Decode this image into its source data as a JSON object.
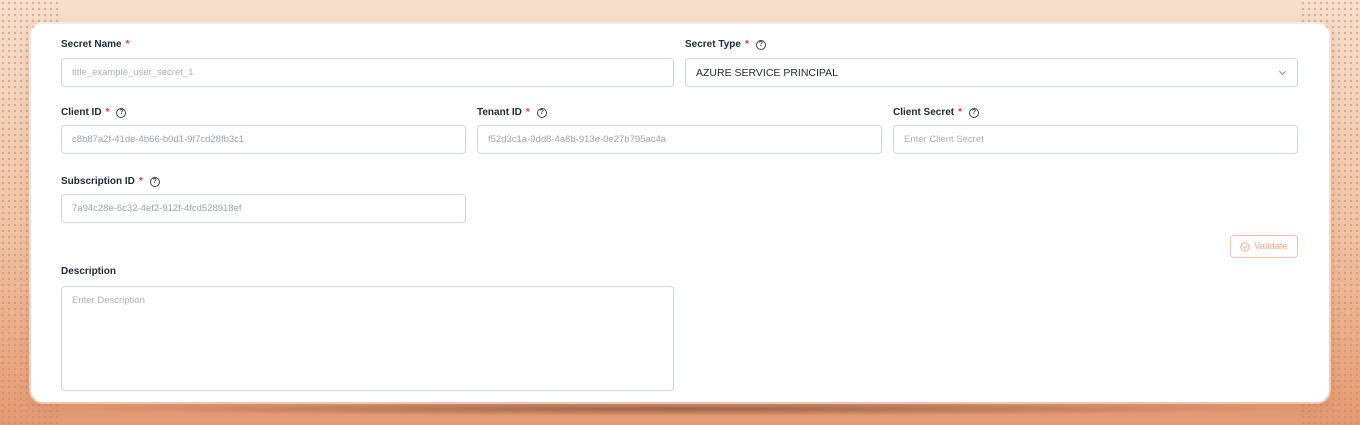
{
  "form": {
    "secret_name": {
      "label": "Secret Name",
      "required_mark": "*",
      "placeholder": "title_example_user_secret_1"
    },
    "secret_type": {
      "label": "Secret Type",
      "required_mark": "*",
      "help_icon": "question-circle-icon",
      "value": "AZURE SERVICE PRINCIPAL",
      "dropdown_icon": "chevron-down-icon"
    },
    "client_id": {
      "label": "Client ID",
      "required_mark": "*",
      "help_icon": "question-circle-icon",
      "value": "c8b87a2f-41de-4b66-b0d1-9f7cd28fb3c1"
    },
    "tenant_id": {
      "label": "Tenant ID",
      "required_mark": "*",
      "help_icon": "question-circle-icon",
      "value": "f52d3c1a-9dd8-4a8b-913e-0e27b795ac4a"
    },
    "client_secret": {
      "label": "Client Secret",
      "required_mark": "*",
      "help_icon": "question-circle-icon",
      "placeholder": "Enter Client Secret"
    },
    "subscription_id": {
      "label": "Subscription ID",
      "required_mark": "*",
      "help_icon": "question-circle-icon",
      "value": "7a94c28e-6c32-4ef2-912f-4fcd528918ef"
    },
    "validate_button": {
      "label": "Validate",
      "icon": "check-circle-icon",
      "disabled": true
    },
    "description": {
      "label": "Description",
      "placeholder": "Enter Description"
    }
  },
  "colors": {
    "required": "#e03b3b",
    "validate_disabled": "#f0a98a",
    "background_top": "#f6dfcd",
    "background_bottom": "#e59a73"
  }
}
